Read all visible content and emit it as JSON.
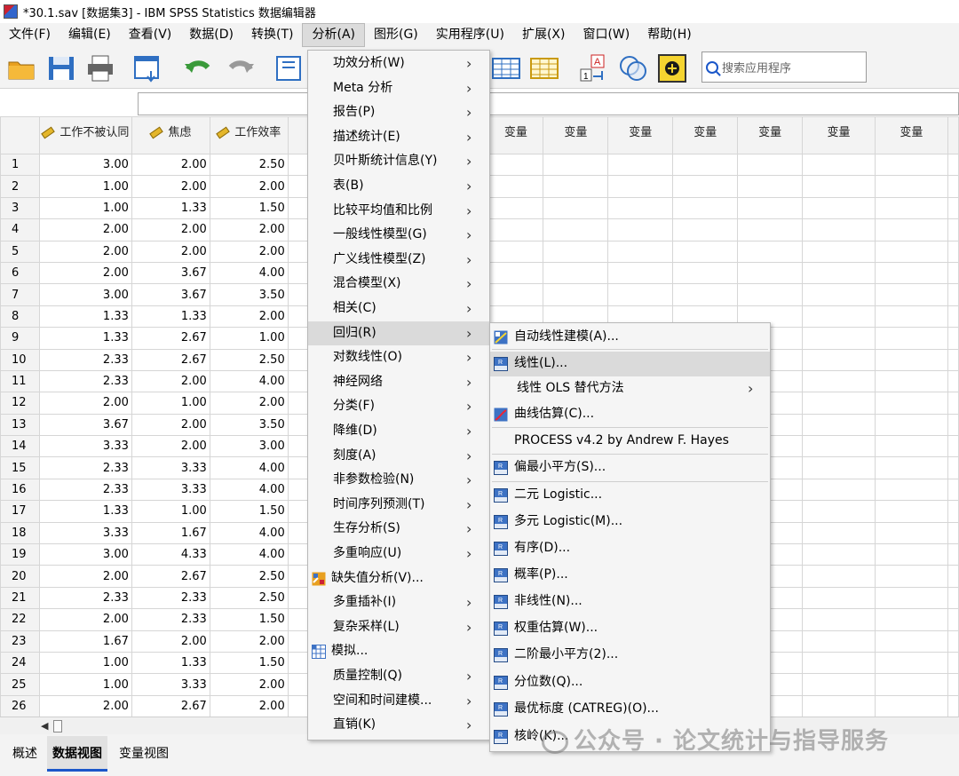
{
  "window": {
    "title": "*30.1.sav [数据集3] - IBM SPSS Statistics 数据编辑器"
  },
  "menubar": [
    {
      "label": "文件(F)"
    },
    {
      "label": "编辑(E)"
    },
    {
      "label": "查看(V)"
    },
    {
      "label": "数据(D)"
    },
    {
      "label": "转换(T)"
    },
    {
      "label": "分析(A)"
    },
    {
      "label": "图形(G)"
    },
    {
      "label": "实用程序(U)"
    },
    {
      "label": "扩展(X)"
    },
    {
      "label": "窗口(W)"
    },
    {
      "label": "帮助(H)"
    }
  ],
  "toolbar": {
    "search_placeholder": "搜索应用程序"
  },
  "grid": {
    "columns": [
      "工作不被认同",
      "焦虑",
      "工作效率"
    ],
    "var_header": "变量",
    "rows": [
      [
        "3.00",
        "2.00",
        "2.50"
      ],
      [
        "1.00",
        "2.00",
        "2.00"
      ],
      [
        "1.00",
        "1.33",
        "1.50"
      ],
      [
        "2.00",
        "2.00",
        "2.00"
      ],
      [
        "2.00",
        "2.00",
        "2.00"
      ],
      [
        "2.00",
        "3.67",
        "4.00"
      ],
      [
        "3.00",
        "3.67",
        "3.50"
      ],
      [
        "1.33",
        "1.33",
        "2.00"
      ],
      [
        "1.33",
        "2.67",
        "1.00"
      ],
      [
        "2.33",
        "2.67",
        "2.50"
      ],
      [
        "2.33",
        "2.00",
        "4.00"
      ],
      [
        "2.00",
        "1.00",
        "2.00"
      ],
      [
        "3.67",
        "2.00",
        "3.50"
      ],
      [
        "3.33",
        "2.00",
        "3.00"
      ],
      [
        "2.33",
        "3.33",
        "4.00"
      ],
      [
        "2.33",
        "3.33",
        "4.00"
      ],
      [
        "1.33",
        "1.00",
        "1.50"
      ],
      [
        "3.33",
        "1.67",
        "4.00"
      ],
      [
        "3.00",
        "4.33",
        "4.00"
      ],
      [
        "2.00",
        "2.67",
        "2.50"
      ],
      [
        "2.33",
        "2.33",
        "2.50"
      ],
      [
        "2.00",
        "2.33",
        "1.50"
      ],
      [
        "1.67",
        "2.00",
        "2.00"
      ],
      [
        "1.00",
        "1.33",
        "1.50"
      ],
      [
        "1.00",
        "3.33",
        "2.00"
      ],
      [
        "2.00",
        "2.67",
        "2.00"
      ]
    ]
  },
  "analyze_menu": [
    {
      "label": "功效分析(W)",
      "sub": true
    },
    {
      "label": "Meta 分析",
      "sub": true
    },
    {
      "label": "报告(P)",
      "sub": true
    },
    {
      "label": "描述统计(E)",
      "sub": true
    },
    {
      "label": "贝叶斯统计信息(Y)",
      "sub": true
    },
    {
      "label": "表(B)",
      "sub": true
    },
    {
      "label": "比较平均值和比例",
      "sub": true
    },
    {
      "label": "一般线性模型(G)",
      "sub": true
    },
    {
      "label": "广义线性模型(Z)",
      "sub": true
    },
    {
      "label": "混合模型(X)",
      "sub": true
    },
    {
      "label": "相关(C)",
      "sub": true
    },
    {
      "label": "回归(R)",
      "sub": true,
      "highlight": true
    },
    {
      "label": "对数线性(O)",
      "sub": true
    },
    {
      "label": "神经网络",
      "sub": true
    },
    {
      "label": "分类(F)",
      "sub": true
    },
    {
      "label": "降维(D)",
      "sub": true
    },
    {
      "label": "刻度(A)",
      "sub": true
    },
    {
      "label": "非参数检验(N)",
      "sub": true
    },
    {
      "label": "时间序列预测(T)",
      "sub": true
    },
    {
      "label": "生存分析(S)",
      "sub": true
    },
    {
      "label": "多重响应(U)",
      "sub": true
    },
    {
      "label": "缺失值分析(V)...",
      "sub": false,
      "icon": "missing-values-icon"
    },
    {
      "label": "多重插补(I)",
      "sub": true
    },
    {
      "label": "复杂采样(L)",
      "sub": true
    },
    {
      "label": "模拟...",
      "sub": false,
      "icon": "simulation-icon"
    },
    {
      "label": "质量控制(Q)",
      "sub": true
    },
    {
      "label": "空间和时间建模...",
      "sub": true
    },
    {
      "label": "直销(K)",
      "sub": true
    }
  ],
  "regression_menu": [
    {
      "label": "自动线性建模(A)...",
      "icon": "auto-linear-icon",
      "badge": ""
    },
    {
      "label": "线性(L)...",
      "icon": "linear-icon",
      "badge": "LIN",
      "highlight": true
    },
    {
      "label": "线性 OLS 替代方法",
      "sub": true
    },
    {
      "label": "曲线估算(C)...",
      "icon": "curve-estimation-icon",
      "badge": ""
    },
    {
      "label": "PROCESS v4.2 by Andrew F. Hayes"
    },
    {
      "label": "偏最小平方(S)...",
      "icon": "pls-icon",
      "badge": "PLS"
    },
    {
      "label": "二元 Logistic...",
      "icon": "binary-logistic-icon",
      "badge": "LOG"
    },
    {
      "label": "多元 Logistic(M)...",
      "icon": "multinomial-logistic-icon",
      "badge": "MLR"
    },
    {
      "label": "有序(D)...",
      "icon": "ordinal-icon",
      "badge": "ORD"
    },
    {
      "label": "概率(P)...",
      "icon": "probit-icon",
      "badge": "PRB"
    },
    {
      "label": "非线性(N)...",
      "icon": "nonlinear-icon",
      "badge": "NLR"
    },
    {
      "label": "权重估算(W)...",
      "icon": "weight-estimation-icon",
      "badge": "WLS"
    },
    {
      "label": "二阶最小平方(2)...",
      "icon": "2sls-icon",
      "badge": "2SLS"
    },
    {
      "label": "分位数(Q)...",
      "icon": "quantile-icon",
      "badge": "QUA"
    },
    {
      "label": "最优标度 (CATREG)(O)...",
      "icon": "catreg-icon",
      "badge": "CAT"
    },
    {
      "label": "核岭(K)...",
      "icon": "kernel-ridge-icon",
      "badge": "KRR"
    }
  ],
  "bottom_tabs": [
    {
      "label": "概述"
    },
    {
      "label": "数据视图",
      "active": true
    },
    {
      "label": "变量视图"
    }
  ],
  "watermark": "公众号 · 论文统计与指导服务"
}
